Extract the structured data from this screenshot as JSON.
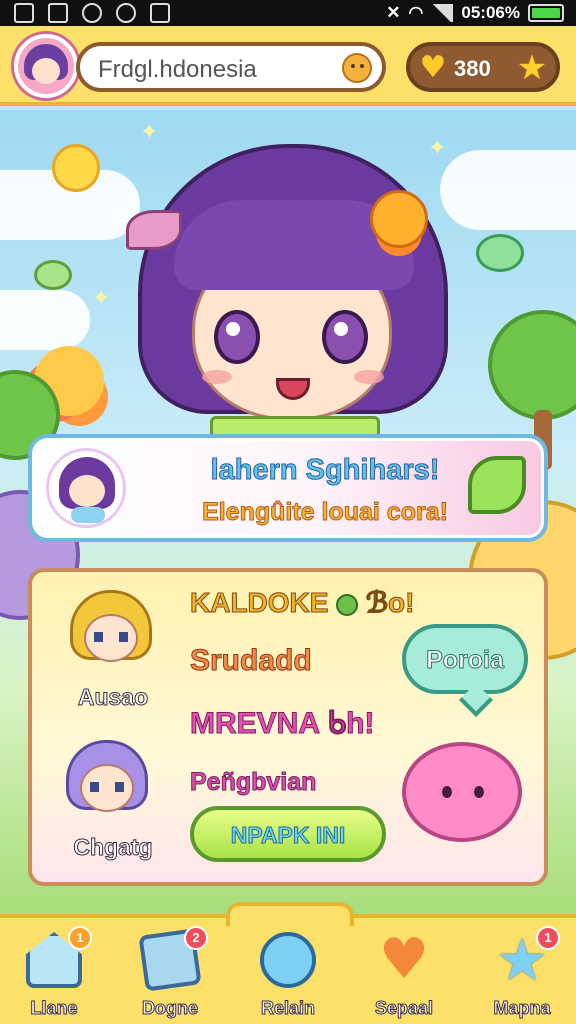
{
  "status_bar": {
    "battery_text": "05:06%",
    "icons": [
      "gmail-icon",
      "image-icon",
      "timer-icon",
      "tips-icon",
      "image-icon",
      "mute-icon",
      "wifi-icon",
      "signal-icon",
      "battery-icon"
    ]
  },
  "header": {
    "search_value": "Frdgl.hdonesia",
    "currency_value": "380"
  },
  "banner": {
    "title": "lahern Sghihars!",
    "subtitle": "Elengûite louai cora!"
  },
  "panel": {
    "line1": "KALDOKE",
    "line1_suffix": "ℬo!",
    "line2": "Srudadd",
    "line3": "MREVNA ᑲh!",
    "line4": "Peñgbvian",
    "bubble_label": "Poroia",
    "cta_label": "NPAPK INI",
    "character1_name": "Ausao",
    "character2_name": "Chgatg"
  },
  "bottom_nav": {
    "items": [
      {
        "label": "Llane",
        "badge": "1",
        "icon": "home-icon"
      },
      {
        "label": "Dogne",
        "badge": "2",
        "icon": "book-icon"
      },
      {
        "label": "Relain",
        "badge": "",
        "icon": "chat-icon"
      },
      {
        "label": "Sepaal",
        "badge": "",
        "icon": "heart-icon"
      },
      {
        "label": "Mapna",
        "badge": "1",
        "icon": "star-icon"
      }
    ]
  },
  "colors": {
    "header_bg": "#fde06a",
    "accent_pink": "#e64fb1",
    "accent_blue": "#5dc4ee",
    "accent_green": "#a8e24a"
  }
}
